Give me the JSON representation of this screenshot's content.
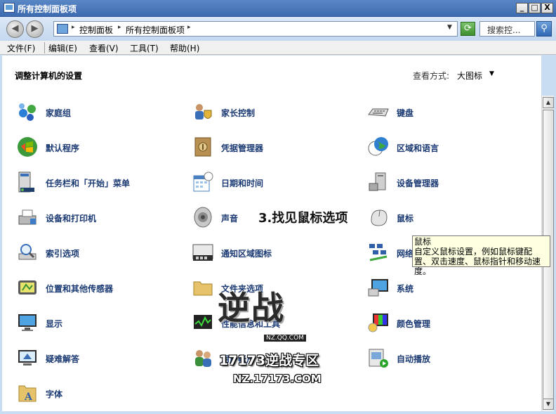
{
  "window": {
    "title": "所有控制面板项",
    "min": "_",
    "max": "□",
    "close": "X"
  },
  "address": {
    "crumbs": [
      "控制面板",
      "所有控制面板项"
    ],
    "search_placeholder": "搜索控..."
  },
  "menu": [
    "文件(F)",
    "编辑(E)",
    "查看(V)",
    "工具(T)",
    "帮助(H)"
  ],
  "content": {
    "heading": "调整计算机的设置",
    "view_by_label": "查看方式:",
    "view_by_value": "大图标"
  },
  "items": {
    "col1": [
      "家庭组",
      "默认程序",
      "任务栏和「开始」菜单",
      "设备和打印机",
      "索引选项",
      "位置和其他传感器",
      "显示",
      "疑难解答",
      "字体"
    ],
    "col2": [
      "家长控制",
      "凭据管理器",
      "日期和时间",
      "声音",
      "通知区域图标",
      "文件夹选项",
      "性能信息和工具",
      "用户帐户"
    ],
    "col3": [
      "键盘",
      "区域和语言",
      "设备管理器",
      "鼠标",
      "网络和共享中心",
      "系统",
      "颜色管理",
      "自动播放"
    ]
  },
  "tooltip": {
    "title": "鼠标",
    "text": "自定义鼠标设置，例如鼠标键配置、双击速度、鼠标指针和移动速度。"
  },
  "annotation": "3.找见鼠标选项",
  "watermark": {
    "logo": "逆战",
    "sub": "NZ.QQ.COM",
    "line1": "17173逆战专区",
    "line2": "NZ.17173.COM"
  }
}
